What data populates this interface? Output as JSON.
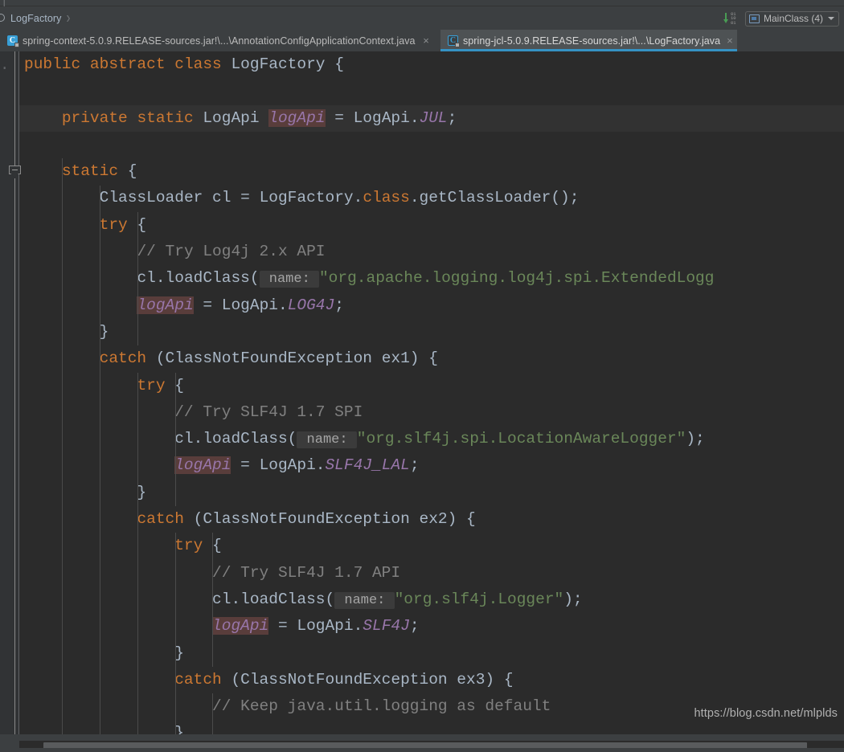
{
  "window": {
    "theme_bg": "#3c3f41",
    "editor_bg": "#2b2b2b",
    "accent": "#3592c4"
  },
  "breadcrumb": {
    "icon": "class-circle-icon",
    "label": "LogFactory",
    "separator": "›"
  },
  "run_widget": {
    "binary_icon": "download-binary-icon",
    "binary_digits_line1": "01",
    "binary_digits_line2": "10",
    "binary_digits_line3": "01",
    "config_icon": "run-configuration-icon",
    "config_label": "MainClass (4)",
    "caret_icon": "chevron-down-icon"
  },
  "tabs": [
    {
      "label": "spring-context-5.0.9.RELEASE-sources.jar!\\...\\AnnotationConfigApplicationContext.java",
      "icon_letter": "C",
      "active": false,
      "close_glyph": "×"
    },
    {
      "label": "spring-jcl-5.0.9.RELEASE-sources.jar!\\...\\LogFactory.java",
      "icon_letter": "C",
      "active": true,
      "close_glyph": "×"
    }
  ],
  "editor": {
    "language": "java",
    "file": "LogFactory.java",
    "ghost_linenum": "·",
    "code_lines": [
      {
        "id": "l1",
        "caret": false,
        "tokens": [
          {
            "t": "public",
            "c": "kw"
          },
          {
            "t": " ",
            "c": "pln"
          },
          {
            "t": "abstract",
            "c": "kw"
          },
          {
            "t": " ",
            "c": "pln"
          },
          {
            "t": "class",
            "c": "kw"
          },
          {
            "t": " ",
            "c": "pln"
          },
          {
            "t": "LogFactory",
            "c": "cls"
          },
          {
            "t": " {",
            "c": "pln"
          }
        ]
      },
      {
        "id": "l2",
        "caret": false,
        "tokens": []
      },
      {
        "id": "l3",
        "caret": true,
        "tokens": [
          {
            "t": "    ",
            "c": "pln"
          },
          {
            "t": "private",
            "c": "kw"
          },
          {
            "t": " ",
            "c": "pln"
          },
          {
            "t": "static",
            "c": "kw"
          },
          {
            "t": " ",
            "c": "pln"
          },
          {
            "t": "LogApi",
            "c": "cls"
          },
          {
            "t": " ",
            "c": "pln"
          },
          {
            "t": "logApi",
            "c": "fldhl"
          },
          {
            "t": " = ",
            "c": "pln"
          },
          {
            "t": "LogApi.",
            "c": "cls"
          },
          {
            "t": "JUL",
            "c": "cst"
          },
          {
            "t": ";",
            "c": "pln"
          }
        ]
      },
      {
        "id": "l4",
        "caret": false,
        "tokens": []
      },
      {
        "id": "l5",
        "caret": false,
        "tokens": [
          {
            "t": "    ",
            "c": "pln"
          },
          {
            "t": "static",
            "c": "kw"
          },
          {
            "t": " {",
            "c": "pln"
          }
        ]
      },
      {
        "id": "l6",
        "caret": false,
        "tokens": [
          {
            "t": "        ",
            "c": "pln"
          },
          {
            "t": "ClassLoader",
            "c": "cls"
          },
          {
            "t": " cl = ",
            "c": "pln"
          },
          {
            "t": "LogFactory.",
            "c": "cls"
          },
          {
            "t": "class",
            "c": "kw"
          },
          {
            "t": ".getClassLoader();",
            "c": "pln"
          }
        ]
      },
      {
        "id": "l7",
        "caret": false,
        "tokens": [
          {
            "t": "        ",
            "c": "pln"
          },
          {
            "t": "try",
            "c": "kw"
          },
          {
            "t": " {",
            "c": "pln"
          }
        ]
      },
      {
        "id": "l8",
        "caret": false,
        "tokens": [
          {
            "t": "            ",
            "c": "pln"
          },
          {
            "t": "// Try Log4j 2.x API",
            "c": "cmt"
          }
        ]
      },
      {
        "id": "l9",
        "caret": false,
        "hint_at": 3,
        "tokens": [
          {
            "t": "            ",
            "c": "pln"
          },
          {
            "t": "cl.loadClass(",
            "c": "pln"
          },
          {
            "t": " name: ",
            "c": "hint"
          },
          {
            "t": "\"org.apache.logging.log4j.spi.ExtendedLogg",
            "c": "str"
          }
        ]
      },
      {
        "id": "l10",
        "caret": false,
        "tokens": [
          {
            "t": "            ",
            "c": "pln"
          },
          {
            "t": "logApi",
            "c": "fldhl"
          },
          {
            "t": " = ",
            "c": "pln"
          },
          {
            "t": "LogApi.",
            "c": "cls"
          },
          {
            "t": "LOG4J",
            "c": "cst"
          },
          {
            "t": ";",
            "c": "pln"
          }
        ]
      },
      {
        "id": "l11",
        "caret": false,
        "tokens": [
          {
            "t": "        }",
            "c": "pln"
          }
        ]
      },
      {
        "id": "l12",
        "caret": false,
        "tokens": [
          {
            "t": "        ",
            "c": "pln"
          },
          {
            "t": "catch",
            "c": "kw"
          },
          {
            "t": " (",
            "c": "pln"
          },
          {
            "t": "ClassNotFoundException",
            "c": "cls"
          },
          {
            "t": " ex1) {",
            "c": "pln"
          }
        ]
      },
      {
        "id": "l13",
        "caret": false,
        "tokens": [
          {
            "t": "            ",
            "c": "pln"
          },
          {
            "t": "try",
            "c": "kw"
          },
          {
            "t": " {",
            "c": "pln"
          }
        ]
      },
      {
        "id": "l14",
        "caret": false,
        "tokens": [
          {
            "t": "                ",
            "c": "pln"
          },
          {
            "t": "// Try SLF4J 1.7 SPI",
            "c": "cmt"
          }
        ]
      },
      {
        "id": "l15",
        "caret": false,
        "tokens": [
          {
            "t": "                ",
            "c": "pln"
          },
          {
            "t": "cl.loadClass(",
            "c": "pln"
          },
          {
            "t": " name: ",
            "c": "hint"
          },
          {
            "t": "\"org.slf4j.spi.LocationAwareLogger\"",
            "c": "str"
          },
          {
            "t": ");",
            "c": "pln"
          }
        ]
      },
      {
        "id": "l16",
        "caret": false,
        "tokens": [
          {
            "t": "                ",
            "c": "pln"
          },
          {
            "t": "logApi",
            "c": "fldhl"
          },
          {
            "t": " = ",
            "c": "pln"
          },
          {
            "t": "LogApi.",
            "c": "cls"
          },
          {
            "t": "SLF4J_LAL",
            "c": "cst"
          },
          {
            "t": ";",
            "c": "pln"
          }
        ]
      },
      {
        "id": "l17",
        "caret": false,
        "tokens": [
          {
            "t": "            }",
            "c": "pln"
          }
        ]
      },
      {
        "id": "l18",
        "caret": false,
        "tokens": [
          {
            "t": "            ",
            "c": "pln"
          },
          {
            "t": "catch",
            "c": "kw"
          },
          {
            "t": " (",
            "c": "pln"
          },
          {
            "t": "ClassNotFoundException",
            "c": "cls"
          },
          {
            "t": " ex2) {",
            "c": "pln"
          }
        ]
      },
      {
        "id": "l19",
        "caret": false,
        "tokens": [
          {
            "t": "                ",
            "c": "pln"
          },
          {
            "t": "try",
            "c": "kw"
          },
          {
            "t": " {",
            "c": "pln"
          }
        ]
      },
      {
        "id": "l20",
        "caret": false,
        "tokens": [
          {
            "t": "                    ",
            "c": "pln"
          },
          {
            "t": "// Try SLF4J 1.7 API",
            "c": "cmt"
          }
        ]
      },
      {
        "id": "l21",
        "caret": false,
        "tokens": [
          {
            "t": "                    ",
            "c": "pln"
          },
          {
            "t": "cl.loadClass(",
            "c": "pln"
          },
          {
            "t": " name: ",
            "c": "hint"
          },
          {
            "t": "\"org.slf4j.Logger\"",
            "c": "str"
          },
          {
            "t": ");",
            "c": "pln"
          }
        ]
      },
      {
        "id": "l22",
        "caret": false,
        "tokens": [
          {
            "t": "                    ",
            "c": "pln"
          },
          {
            "t": "logApi",
            "c": "fldhl"
          },
          {
            "t": " = ",
            "c": "pln"
          },
          {
            "t": "LogApi.",
            "c": "cls"
          },
          {
            "t": "SLF4J",
            "c": "cst"
          },
          {
            "t": ";",
            "c": "pln"
          }
        ]
      },
      {
        "id": "l23",
        "caret": false,
        "tokens": [
          {
            "t": "                }",
            "c": "pln"
          }
        ]
      },
      {
        "id": "l24",
        "caret": false,
        "tokens": [
          {
            "t": "                ",
            "c": "pln"
          },
          {
            "t": "catch",
            "c": "kw"
          },
          {
            "t": " (",
            "c": "pln"
          },
          {
            "t": "ClassNotFoundException",
            "c": "cls"
          },
          {
            "t": " ex3) {",
            "c": "pln"
          }
        ]
      },
      {
        "id": "l25",
        "caret": false,
        "tokens": [
          {
            "t": "                    ",
            "c": "pln"
          },
          {
            "t": "// Keep java.util.logging as default",
            "c": "cmt"
          }
        ]
      },
      {
        "id": "l26",
        "caret": false,
        "tokens": [
          {
            "t": "                }",
            "c": "pln"
          }
        ]
      }
    ],
    "fold_marker": "collapse-fold-icon"
  },
  "watermark": {
    "text": "https://blog.csdn.net/mlplds"
  },
  "scrollbar": {
    "orientation": "horizontal",
    "name": "editor-horizontal-scrollbar"
  }
}
